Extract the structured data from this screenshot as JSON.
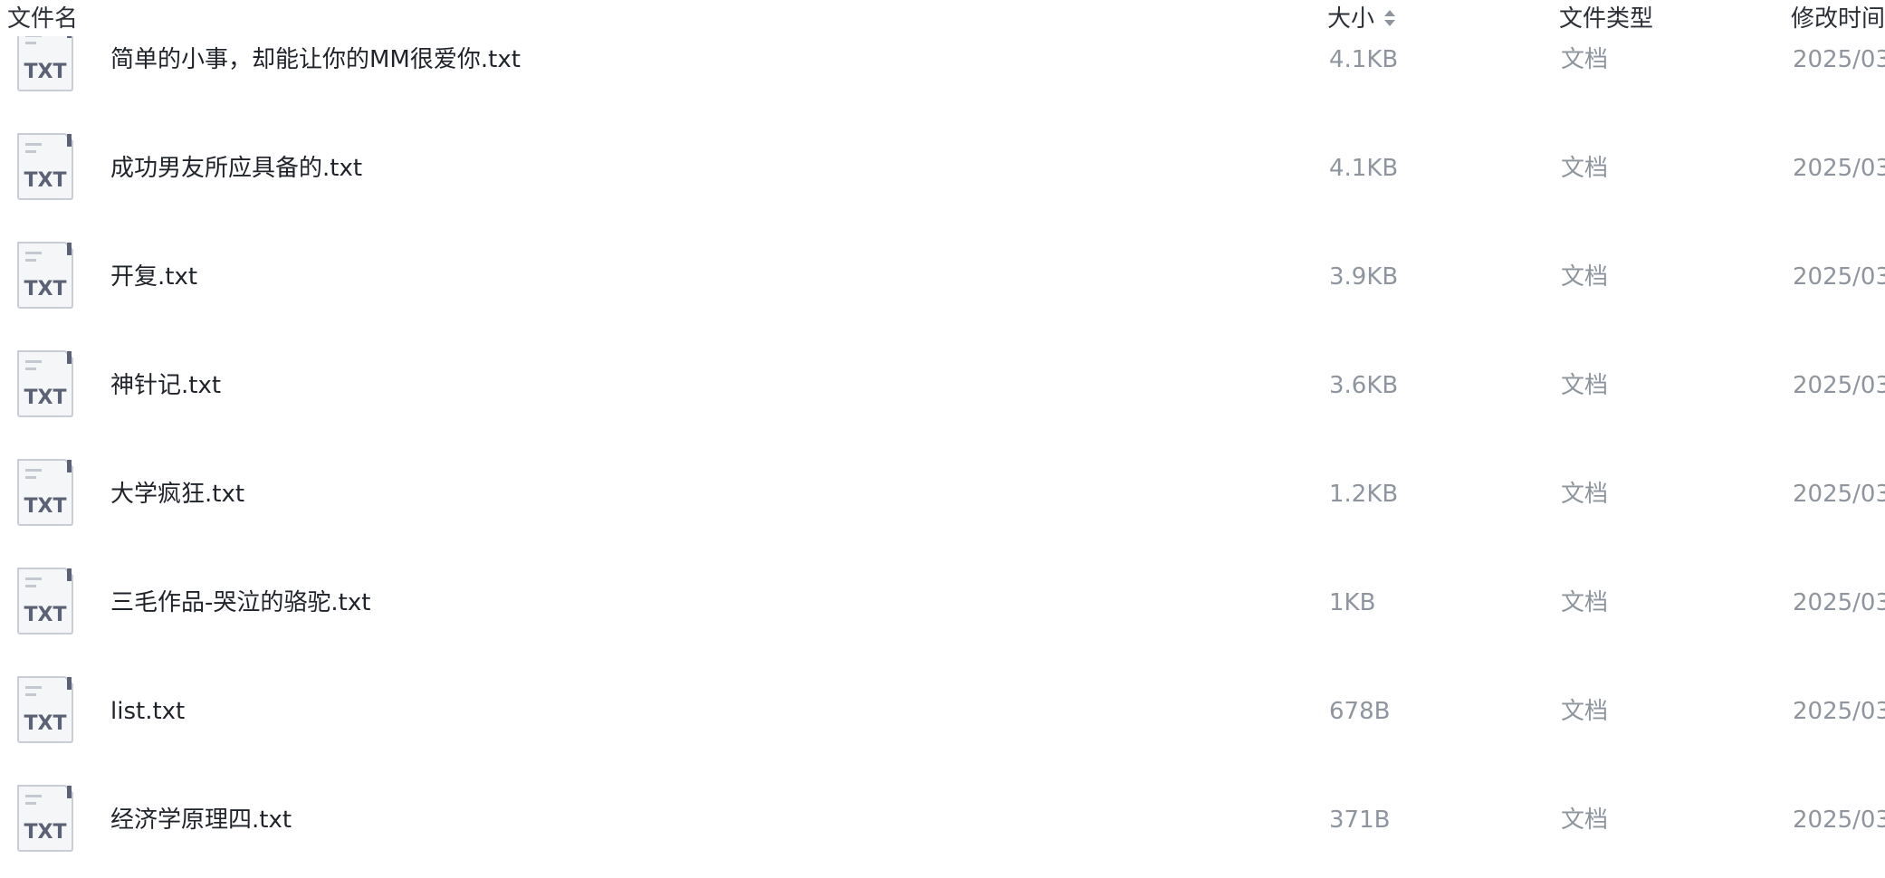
{
  "header": {
    "name": "文件名",
    "size": "大小",
    "type": "文件类型",
    "time": "修改时间"
  },
  "files": [
    {
      "name": "简单的小事，却能让你的MM很爱你.txt",
      "size": "4.1KB",
      "type": "文档",
      "modified": "2025/03/"
    },
    {
      "name": "成功男友所应具备的.txt",
      "size": "4.1KB",
      "type": "文档",
      "modified": "2025/03/"
    },
    {
      "name": "开复.txt",
      "size": "3.9KB",
      "type": "文档",
      "modified": "2025/03/"
    },
    {
      "name": "神针记.txt",
      "size": "3.6KB",
      "type": "文档",
      "modified": "2025/03/"
    },
    {
      "name": "大学疯狂.txt",
      "size": "1.2KB",
      "type": "文档",
      "modified": "2025/03/"
    },
    {
      "name": "三毛作品-哭泣的骆驼.txt",
      "size": "1KB",
      "type": "文档",
      "modified": "2025/03/"
    },
    {
      "name": "list.txt",
      "size": "678B",
      "type": "文档",
      "modified": "2025/03/"
    },
    {
      "name": "经济学原理四.txt",
      "size": "371B",
      "type": "文档",
      "modified": "2025/03/"
    }
  ],
  "icon": {
    "label": "TXT",
    "name": "txt-file-icon"
  }
}
